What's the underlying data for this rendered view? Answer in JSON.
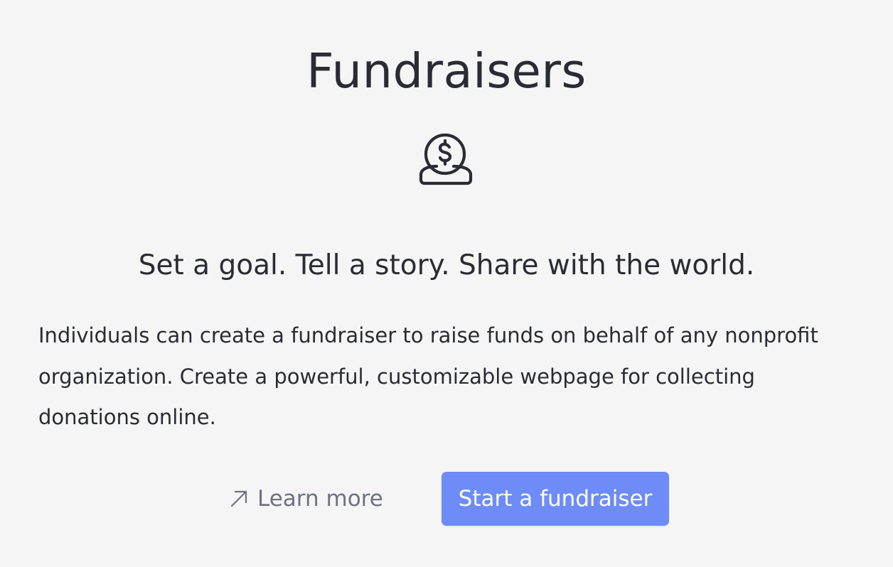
{
  "header": {
    "title": "Fundraisers"
  },
  "icons": {
    "hero": "coin-in-hand-icon",
    "learn_more": "arrow-up-right-icon"
  },
  "intro": {
    "tagline": "Set a goal. Tell a story. Share with the world.",
    "description": "Individuals can create a fundraiser to raise funds on behalf of any nonprofit organization. Create a powerful, customizable webpage for collecting donations online."
  },
  "actions": {
    "learn_more_label": "Learn more",
    "start_label": "Start a fundraiser"
  },
  "colors": {
    "background": "#f5f5f6",
    "text": "#2a2b33",
    "muted": "#6f7180",
    "primary": "#6e8cf8"
  }
}
